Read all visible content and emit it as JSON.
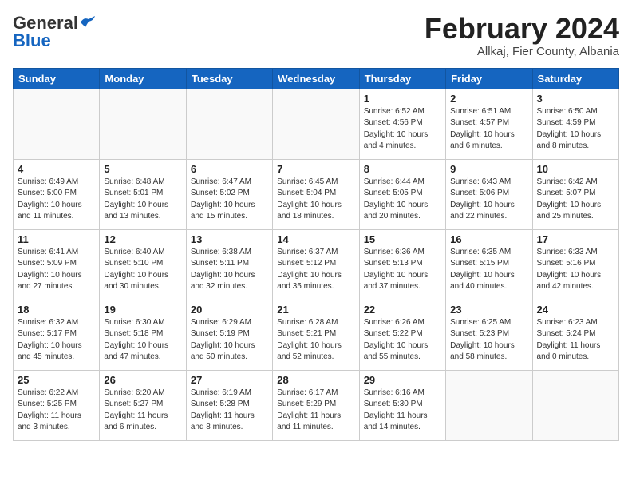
{
  "logo": {
    "line1a": "General",
    "line1b": "Blue",
    "bird": "▶"
  },
  "header": {
    "month": "February 2024",
    "location": "Allkaj, Fier County, Albania"
  },
  "weekdays": [
    "Sunday",
    "Monday",
    "Tuesday",
    "Wednesday",
    "Thursday",
    "Friday",
    "Saturday"
  ],
  "weeks": [
    [
      {
        "day": "",
        "info": ""
      },
      {
        "day": "",
        "info": ""
      },
      {
        "day": "",
        "info": ""
      },
      {
        "day": "",
        "info": ""
      },
      {
        "day": "1",
        "info": "Sunrise: 6:52 AM\nSunset: 4:56 PM\nDaylight: 10 hours\nand 4 minutes."
      },
      {
        "day": "2",
        "info": "Sunrise: 6:51 AM\nSunset: 4:57 PM\nDaylight: 10 hours\nand 6 minutes."
      },
      {
        "day": "3",
        "info": "Sunrise: 6:50 AM\nSunset: 4:59 PM\nDaylight: 10 hours\nand 8 minutes."
      }
    ],
    [
      {
        "day": "4",
        "info": "Sunrise: 6:49 AM\nSunset: 5:00 PM\nDaylight: 10 hours\nand 11 minutes."
      },
      {
        "day": "5",
        "info": "Sunrise: 6:48 AM\nSunset: 5:01 PM\nDaylight: 10 hours\nand 13 minutes."
      },
      {
        "day": "6",
        "info": "Sunrise: 6:47 AM\nSunset: 5:02 PM\nDaylight: 10 hours\nand 15 minutes."
      },
      {
        "day": "7",
        "info": "Sunrise: 6:45 AM\nSunset: 5:04 PM\nDaylight: 10 hours\nand 18 minutes."
      },
      {
        "day": "8",
        "info": "Sunrise: 6:44 AM\nSunset: 5:05 PM\nDaylight: 10 hours\nand 20 minutes."
      },
      {
        "day": "9",
        "info": "Sunrise: 6:43 AM\nSunset: 5:06 PM\nDaylight: 10 hours\nand 22 minutes."
      },
      {
        "day": "10",
        "info": "Sunrise: 6:42 AM\nSunset: 5:07 PM\nDaylight: 10 hours\nand 25 minutes."
      }
    ],
    [
      {
        "day": "11",
        "info": "Sunrise: 6:41 AM\nSunset: 5:09 PM\nDaylight: 10 hours\nand 27 minutes."
      },
      {
        "day": "12",
        "info": "Sunrise: 6:40 AM\nSunset: 5:10 PM\nDaylight: 10 hours\nand 30 minutes."
      },
      {
        "day": "13",
        "info": "Sunrise: 6:38 AM\nSunset: 5:11 PM\nDaylight: 10 hours\nand 32 minutes."
      },
      {
        "day": "14",
        "info": "Sunrise: 6:37 AM\nSunset: 5:12 PM\nDaylight: 10 hours\nand 35 minutes."
      },
      {
        "day": "15",
        "info": "Sunrise: 6:36 AM\nSunset: 5:13 PM\nDaylight: 10 hours\nand 37 minutes."
      },
      {
        "day": "16",
        "info": "Sunrise: 6:35 AM\nSunset: 5:15 PM\nDaylight: 10 hours\nand 40 minutes."
      },
      {
        "day": "17",
        "info": "Sunrise: 6:33 AM\nSunset: 5:16 PM\nDaylight: 10 hours\nand 42 minutes."
      }
    ],
    [
      {
        "day": "18",
        "info": "Sunrise: 6:32 AM\nSunset: 5:17 PM\nDaylight: 10 hours\nand 45 minutes."
      },
      {
        "day": "19",
        "info": "Sunrise: 6:30 AM\nSunset: 5:18 PM\nDaylight: 10 hours\nand 47 minutes."
      },
      {
        "day": "20",
        "info": "Sunrise: 6:29 AM\nSunset: 5:19 PM\nDaylight: 10 hours\nand 50 minutes."
      },
      {
        "day": "21",
        "info": "Sunrise: 6:28 AM\nSunset: 5:21 PM\nDaylight: 10 hours\nand 52 minutes."
      },
      {
        "day": "22",
        "info": "Sunrise: 6:26 AM\nSunset: 5:22 PM\nDaylight: 10 hours\nand 55 minutes."
      },
      {
        "day": "23",
        "info": "Sunrise: 6:25 AM\nSunset: 5:23 PM\nDaylight: 10 hours\nand 58 minutes."
      },
      {
        "day": "24",
        "info": "Sunrise: 6:23 AM\nSunset: 5:24 PM\nDaylight: 11 hours\nand 0 minutes."
      }
    ],
    [
      {
        "day": "25",
        "info": "Sunrise: 6:22 AM\nSunset: 5:25 PM\nDaylight: 11 hours\nand 3 minutes."
      },
      {
        "day": "26",
        "info": "Sunrise: 6:20 AM\nSunset: 5:27 PM\nDaylight: 11 hours\nand 6 minutes."
      },
      {
        "day": "27",
        "info": "Sunrise: 6:19 AM\nSunset: 5:28 PM\nDaylight: 11 hours\nand 8 minutes."
      },
      {
        "day": "28",
        "info": "Sunrise: 6:17 AM\nSunset: 5:29 PM\nDaylight: 11 hours\nand 11 minutes."
      },
      {
        "day": "29",
        "info": "Sunrise: 6:16 AM\nSunset: 5:30 PM\nDaylight: 11 hours\nand 14 minutes."
      },
      {
        "day": "",
        "info": ""
      },
      {
        "day": "",
        "info": ""
      }
    ]
  ]
}
